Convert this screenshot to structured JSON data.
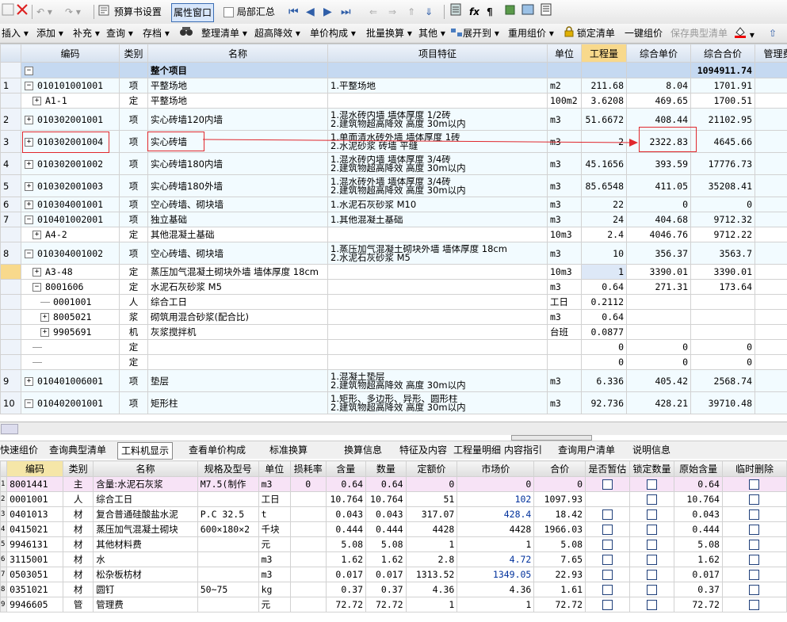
{
  "toolbar1": {
    "budget_settings": "预算书设置",
    "property_window": "属性窗口",
    "partial_summary": "局部汇总"
  },
  "toolbar2": {
    "insert": "插入",
    "add": "添加",
    "supplement": "补充",
    "query": "查询",
    "archive": "存档",
    "organize_list": "整理清单",
    "super_height": "超高降效",
    "unit_price_composition": "单价构成",
    "batch_convert": "批量换算",
    "other": "其他",
    "expand_to": "展开到",
    "reuse_group": "重用组价",
    "lock_list": "锁定清单",
    "one_click_group": "一键组价",
    "save_typical": "保存典型清单"
  },
  "grid_top": {
    "headers": [
      "编码",
      "类别",
      "名称",
      "项目特征",
      "单位",
      "工程量",
      "综合单价",
      "综合合价",
      "管理费"
    ],
    "rows": [
      {
        "no": "",
        "tree": "minus",
        "indent": 0,
        "code": "",
        "type": "",
        "name": "整个项目",
        "feature": "",
        "unit": "",
        "qty": "",
        "price": "",
        "total": "1094911.74",
        "kind": "project"
      },
      {
        "no": "1",
        "tree": "minus",
        "indent": 0,
        "code": "010101001001",
        "type": "项",
        "name": "平整场地",
        "feature": "1.平整场地",
        "unit": "m2",
        "qty": "211.68",
        "price": "8.04",
        "total": "1701.91",
        "kind": "item"
      },
      {
        "no": "",
        "tree": "plus",
        "indent": 1,
        "code": "A1-1",
        "type": "定",
        "name": "平整场地",
        "feature": "",
        "unit": "100m2",
        "qty": "3.6208",
        "price": "469.65",
        "total": "1700.51",
        "kind": "quota"
      },
      {
        "no": "2",
        "tree": "plus",
        "indent": 0,
        "code": "010302001001",
        "type": "项",
        "name": "实心砖墙120内墙",
        "feature": "1.混水砖内墙 墙体厚度 1/2砖\n2.建筑物超高降效 高度 30m以内",
        "unit": "m3",
        "qty": "51.6672",
        "price": "408.44",
        "total": "21102.95",
        "kind": "item2"
      },
      {
        "no": "3",
        "tree": "plus",
        "indent": 0,
        "code": "010302001004",
        "type": "项",
        "name": "实心砖墙",
        "feature": "1.单面清水砖外墙 墙体厚度 1砖\n2.水泥砂浆 砖墙 平缝",
        "unit": "m3",
        "qty": "2",
        "price": "2322.83",
        "total": "4645.66",
        "kind": "item2"
      },
      {
        "no": "4",
        "tree": "plus",
        "indent": 0,
        "code": "010302001002",
        "type": "项",
        "name": "实心砖墙180内墙",
        "feature": "1.混水砖内墙 墙体厚度 3/4砖\n2.建筑物超高降效 高度 30m以内",
        "unit": "m3",
        "qty": "45.1656",
        "price": "393.59",
        "total": "17776.73",
        "kind": "item2"
      },
      {
        "no": "5",
        "tree": "plus",
        "indent": 0,
        "code": "010302001003",
        "type": "项",
        "name": "实心砖墙180外墙",
        "feature": "1.混水砖外墙 墙体厚度 3/4砖\n2.建筑物超高降效 高度 30m以内",
        "unit": "m3",
        "qty": "85.6548",
        "price": "411.05",
        "total": "35208.41",
        "kind": "item2"
      },
      {
        "no": "6",
        "tree": "plus",
        "indent": 0,
        "code": "010304001001",
        "type": "项",
        "name": "空心砖墙、砌块墙",
        "feature": "1.水泥石灰砂浆 M10",
        "unit": "m3",
        "qty": "22",
        "price": "0",
        "total": "0",
        "kind": "item"
      },
      {
        "no": "7",
        "tree": "minus",
        "indent": 0,
        "code": "010401002001",
        "type": "项",
        "name": "独立基础",
        "feature": "1.其他混凝土基础",
        "unit": "m3",
        "qty": "24",
        "price": "404.68",
        "total": "9712.32",
        "kind": "item"
      },
      {
        "no": "",
        "tree": "plus",
        "indent": 1,
        "code": "A4-2",
        "type": "定",
        "name": "其他混凝土基础",
        "feature": "",
        "unit": "10m3",
        "qty": "2.4",
        "price": "4046.76",
        "total": "9712.22",
        "kind": "quota"
      },
      {
        "no": "8",
        "tree": "minus",
        "indent": 0,
        "code": "010304001002",
        "type": "项",
        "name": "空心砖墙、砌块墙",
        "feature": "1.蒸压加气混凝土砌块外墙 墙体厚度 18cm\n2.水泥石灰砂浆 M5",
        "unit": "m3",
        "qty": "10",
        "price": "356.37",
        "total": "3563.7",
        "kind": "item2"
      },
      {
        "no": "",
        "tree": "plus",
        "indent": 1,
        "code": "A3-48",
        "type": "定",
        "name": "蒸压加气混凝土砌块外墙 墙体厚度 18cm",
        "feature": "",
        "unit": "10m3",
        "qty": "1",
        "price": "3390.01",
        "total": "3390.01",
        "kind": "quota",
        "selected": true
      },
      {
        "no": "",
        "tree": "minus",
        "indent": 1,
        "code": "8001606",
        "type": "定",
        "name": "水泥石灰砂浆 M5",
        "feature": "",
        "unit": "m3",
        "qty": "0.64",
        "price": "271.31",
        "total": "173.64",
        "kind": "quota"
      },
      {
        "no": "",
        "tree": "",
        "indent": 2,
        "code": "0001001",
        "type": "人",
        "name": "综合工日",
        "feature": "",
        "unit": "工日",
        "qty": "0.2112",
        "price": "",
        "total": "",
        "kind": "quota"
      },
      {
        "no": "",
        "tree": "plus",
        "indent": 2,
        "code": "8005021",
        "type": "浆",
        "name": "砌筑用混合砂浆(配合比)",
        "feature": "",
        "unit": "m3",
        "qty": "0.64",
        "price": "",
        "total": "",
        "kind": "quota"
      },
      {
        "no": "",
        "tree": "plus",
        "indent": 2,
        "code": "9905691",
        "type": "机",
        "name": "灰浆搅拌机",
        "feature": "",
        "unit": "台班",
        "qty": "0.0877",
        "price": "",
        "total": "",
        "kind": "quota"
      },
      {
        "no": "",
        "tree": "",
        "indent": 1,
        "code": "",
        "type": "定",
        "name": "",
        "feature": "",
        "unit": "",
        "qty": "0",
        "price": "0",
        "total": "0",
        "kind": "quota"
      },
      {
        "no": "",
        "tree": "",
        "indent": 1,
        "code": "",
        "type": "定",
        "name": "",
        "feature": "",
        "unit": "",
        "qty": "0",
        "price": "0",
        "total": "0",
        "kind": "quota"
      },
      {
        "no": "9",
        "tree": "plus",
        "indent": 0,
        "code": "010401006001",
        "type": "项",
        "name": "垫层",
        "feature": "1.混凝土垫层\n2.建筑物超高降效 高度 30m以内",
        "unit": "m3",
        "qty": "6.336",
        "price": "405.42",
        "total": "2568.74",
        "kind": "item2"
      },
      {
        "no": "10",
        "tree": "minus",
        "indent": 0,
        "code": "010402001001",
        "type": "项",
        "name": "矩形柱",
        "feature": "1.矩形、多边形、异形、圆形柱\n2.建筑物超高降效 高度 30m以内",
        "unit": "m3",
        "qty": "92.736",
        "price": "428.21",
        "total": "39710.48",
        "kind": "item2"
      }
    ]
  },
  "tabs": [
    "快速组价",
    "查询典型清单",
    "工料机显示",
    "查看单价构成",
    "标准换算",
    "换算信息",
    "特征及内容",
    "工程量明细",
    "内容指引",
    "查询用户清单",
    "说明信息"
  ],
  "grid_bottom": {
    "headers": [
      "编码",
      "类别",
      "名称",
      "规格及型号",
      "单位",
      "损耗率",
      "含量",
      "数量",
      "定额价",
      "市场价",
      "合价",
      "是否暂估",
      "锁定数量",
      "原始含量",
      "临时删除"
    ],
    "rows": [
      {
        "no": "1",
        "code": "8001441",
        "type": "主",
        "name": "含量:水泥石灰浆",
        "spec": "M7.5(制作",
        "unit": "m3",
        "loss": "0",
        "content": "0.64",
        "qty": "0.64",
        "quota": "0",
        "market": "0",
        "total": "0",
        "est": true,
        "lock": true,
        "orig": "0.64",
        "del": true,
        "highlight": true
      },
      {
        "no": "2",
        "code": "0001001",
        "type": "人",
        "name": "综合工日",
        "spec": "",
        "unit": "工日",
        "loss": "",
        "content": "10.764",
        "qty": "10.764",
        "quota": "51",
        "market": "102",
        "total": "1097.93",
        "est": false,
        "lock": true,
        "orig": "10.764",
        "del": true,
        "bluemarket": true
      },
      {
        "no": "3",
        "code": "0401013",
        "type": "材",
        "name": "复合普通硅酸盐水泥",
        "spec": "P.C  32.5",
        "unit": "t",
        "loss": "",
        "content": "0.043",
        "qty": "0.043",
        "quota": "317.07",
        "market": "428.4",
        "total": "18.42",
        "est": true,
        "lock": true,
        "orig": "0.043",
        "del": true,
        "bluemarket": true
      },
      {
        "no": "4",
        "code": "0415021",
        "type": "材",
        "name": "蒸压加气混凝土砌块",
        "spec": "600×180×2",
        "unit": "千块",
        "loss": "",
        "content": "0.444",
        "qty": "0.444",
        "quota": "4428",
        "market": "4428",
        "total": "1966.03",
        "est": true,
        "lock": true,
        "orig": "0.444",
        "del": true
      },
      {
        "no": "5",
        "code": "9946131",
        "type": "材",
        "name": "其他材料费",
        "spec": "",
        "unit": "元",
        "loss": "",
        "content": "5.08",
        "qty": "5.08",
        "quota": "1",
        "market": "1",
        "total": "5.08",
        "est": true,
        "lock": true,
        "orig": "5.08",
        "del": true
      },
      {
        "no": "6",
        "code": "3115001",
        "type": "材",
        "name": "水",
        "spec": "",
        "unit": "m3",
        "loss": "",
        "content": "1.62",
        "qty": "1.62",
        "quota": "2.8",
        "market": "4.72",
        "total": "7.65",
        "est": true,
        "lock": true,
        "orig": "1.62",
        "del": true,
        "bluemarket": true
      },
      {
        "no": "7",
        "code": "0503051",
        "type": "材",
        "name": "松杂板枋材",
        "spec": "",
        "unit": "m3",
        "loss": "",
        "content": "0.017",
        "qty": "0.017",
        "quota": "1313.52",
        "market": "1349.05",
        "total": "22.93",
        "est": true,
        "lock": true,
        "orig": "0.017",
        "del": true,
        "bluemarket": true
      },
      {
        "no": "8",
        "code": "0351021",
        "type": "材",
        "name": "圆钉",
        "spec": "50~75",
        "unit": "kg",
        "loss": "",
        "content": "0.37",
        "qty": "0.37",
        "quota": "4.36",
        "market": "4.36",
        "total": "1.61",
        "est": true,
        "lock": true,
        "orig": "0.37",
        "del": true
      },
      {
        "no": "9",
        "code": "9946605",
        "type": "管",
        "name": "管理费",
        "spec": "",
        "unit": "元",
        "loss": "",
        "content": "72.72",
        "qty": "72.72",
        "quota": "1",
        "market": "1",
        "total": "72.72",
        "est": true,
        "lock": true,
        "orig": "72.72",
        "del": true
      }
    ]
  }
}
